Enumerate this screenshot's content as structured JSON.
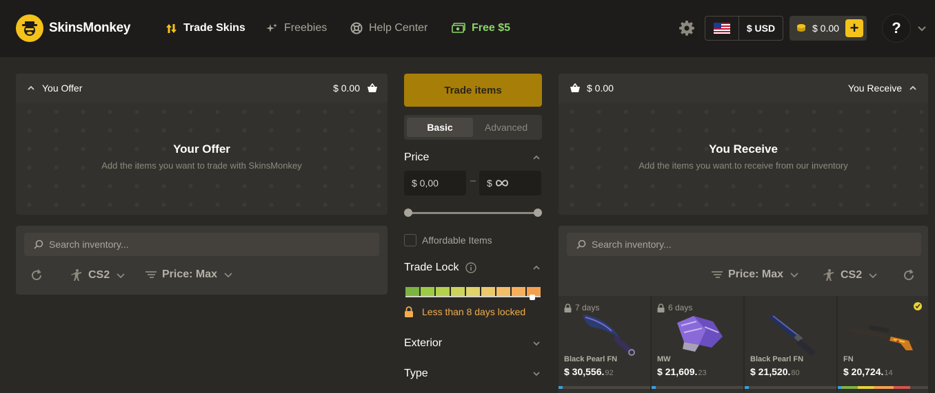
{
  "brand": {
    "name": "SkinsMonkey"
  },
  "nav": {
    "links": [
      {
        "label": "Trade Skins",
        "icon": "arrows-up-down-icon"
      },
      {
        "label": "Freebies",
        "icon": "sparkles-icon"
      },
      {
        "label": "Help Center",
        "icon": "lifebuoy-icon"
      },
      {
        "label": "Free $5",
        "icon": "cash-icon"
      }
    ],
    "currency": "$ USD",
    "balance": "$ 0.00",
    "help": "?"
  },
  "you_offer": {
    "header_label": "You Offer",
    "header_amount": "$ 0.00",
    "empty_title": "Your Offer",
    "empty_subtitle": "Add the items you want to trade with SkinsMonkey",
    "search_placeholder": "Search inventory...",
    "game_filter": "CS2",
    "price_filter": "Price: Max"
  },
  "you_receive": {
    "header_label": "You Receive",
    "header_amount": "$ 0.00",
    "empty_title": "You Receive",
    "empty_subtitle": "Add the items you want to receive from our inventory",
    "search_placeholder": "Search inventory...",
    "price_filter": "Price: Max",
    "game_filter": "CS2"
  },
  "filters": {
    "trade_button": "Trade items",
    "modes": [
      "Basic",
      "Advanced"
    ],
    "active_mode": "Basic",
    "price_title": "Price",
    "price_min": "$ 0,00",
    "price_max_prefix": "$",
    "affordable_label": "Affordable Items",
    "affordable_checked": false,
    "trade_lock_title": "Trade Lock",
    "trade_lock_scale_colors": [
      "#7cb342",
      "#9ccc47",
      "#b5d04c",
      "#cdd45a",
      "#dfd36a",
      "#ecca6c",
      "#f3be68",
      "#f6af5c",
      "#f4a14f"
    ],
    "trade_lock_message": "Less than 8 days locked",
    "exterior_title": "Exterior",
    "type_title": "Type"
  },
  "items": [
    {
      "lock": "7 days",
      "wear": "Black Pearl FN",
      "price_main": "$ 30,556.",
      "price_cents": "92",
      "icon": "karambit-knife-icon"
    },
    {
      "lock": "6 days",
      "wear": "MW",
      "price_main": "$ 21,609.",
      "price_cents": "23",
      "icon": "gloves-icon"
    },
    {
      "lock": "",
      "wear": "Black Pearl FN",
      "price_main": "$ 21,520.",
      "price_cents": "80",
      "icon": "bayonet-knife-icon"
    },
    {
      "lock": "",
      "wear": "FN",
      "price_main": "$ 20,724.",
      "price_cents": "14",
      "icon": "sniper-rifle-icon"
    }
  ],
  "colors": {
    "accent": "#f4c21a",
    "trade_button": "#a77e07",
    "promo": "#8bd46a",
    "lock_warning": "#f0ad4e"
  }
}
